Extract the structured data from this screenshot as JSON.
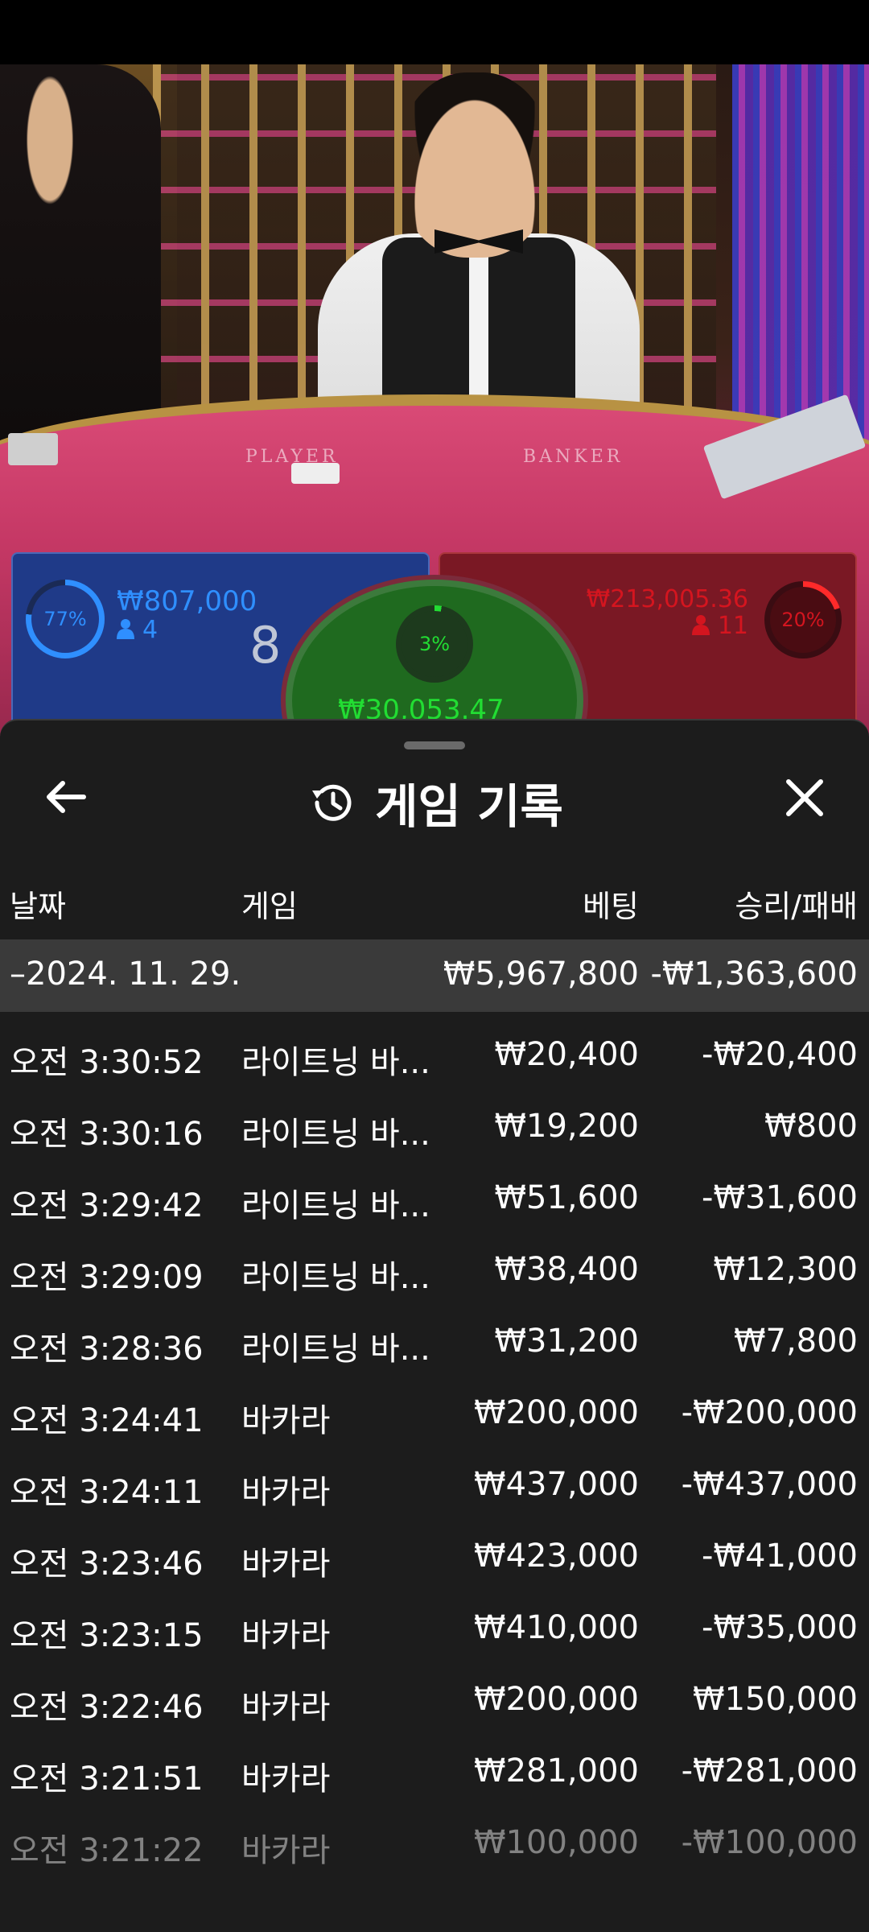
{
  "video": {
    "table_labels": {
      "player": "PLAYER",
      "banker": "BANKER"
    },
    "player": {
      "percent": "77%",
      "amount": "₩807,000",
      "count": "4",
      "score": "8",
      "color": "#2f8fff"
    },
    "banker": {
      "percent": "20%",
      "amount": "₩213,005.36",
      "count": "11",
      "color": "#d4151f"
    },
    "tie": {
      "percent": "3%",
      "amount": "₩30,053.47",
      "color": "#22dd33"
    }
  },
  "sheet": {
    "title": "게임 기록",
    "back_icon": "arrow-left-icon",
    "close_icon": "close-icon",
    "title_icon": "history-icon",
    "columns": {
      "date": "날짜",
      "game": "게임",
      "bet": "베팅",
      "result": "승리/패배"
    },
    "day": {
      "date": "–2024. 11. 29.",
      "bet": "₩5,967,800",
      "result": "-₩1,363,600"
    },
    "rows": [
      {
        "time": "오전 3:30:52",
        "game": "라이트닝 바...",
        "bet": "₩20,400",
        "result": "-₩20,400"
      },
      {
        "time": "오전 3:30:16",
        "game": "라이트닝 바...",
        "bet": "₩19,200",
        "result": "₩800"
      },
      {
        "time": "오전 3:29:42",
        "game": "라이트닝 바...",
        "bet": "₩51,600",
        "result": "-₩31,600"
      },
      {
        "time": "오전 3:29:09",
        "game": "라이트닝 바...",
        "bet": "₩38,400",
        "result": "₩12,300"
      },
      {
        "time": "오전 3:28:36",
        "game": "라이트닝 바...",
        "bet": "₩31,200",
        "result": "₩7,800"
      },
      {
        "time": "오전 3:24:41",
        "game": "바카라",
        "bet": "₩200,000",
        "result": "-₩200,000"
      },
      {
        "time": "오전 3:24:11",
        "game": "바카라",
        "bet": "₩437,000",
        "result": "-₩437,000"
      },
      {
        "time": "오전 3:23:46",
        "game": "바카라",
        "bet": "₩423,000",
        "result": "-₩41,000"
      },
      {
        "time": "오전 3:23:15",
        "game": "바카라",
        "bet": "₩410,000",
        "result": "-₩35,000"
      },
      {
        "time": "오전 3:22:46",
        "game": "바카라",
        "bet": "₩200,000",
        "result": "₩150,000"
      },
      {
        "time": "오전 3:21:51",
        "game": "바카라",
        "bet": "₩281,000",
        "result": "-₩281,000"
      },
      {
        "time": "오전 3:21:22",
        "game": "바카라",
        "bet": "₩100,000",
        "result": "-₩100,000"
      }
    ]
  }
}
